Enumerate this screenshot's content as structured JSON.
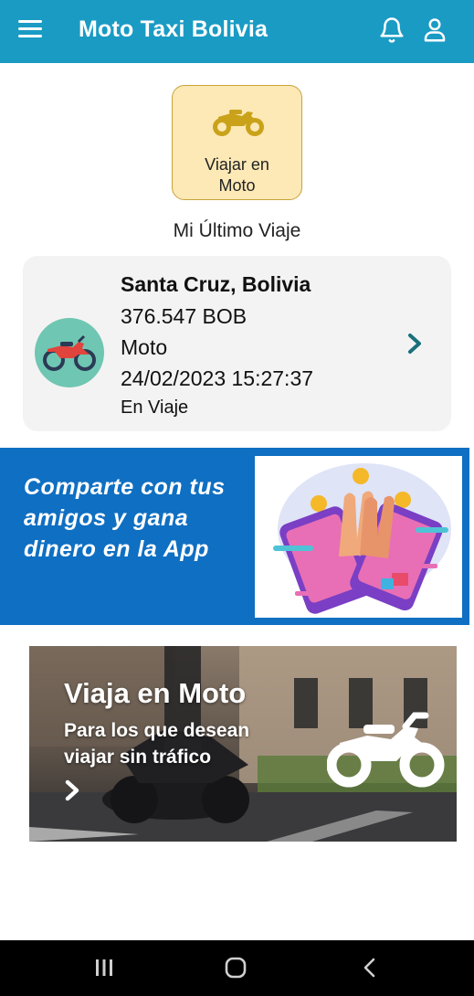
{
  "app": {
    "title": "Moto Taxi Bolivia"
  },
  "icons": {
    "menu": "hamburger-menu-icon",
    "notifications": "bell-icon",
    "profile": "user-icon"
  },
  "ride_option": {
    "label": "Viajar en Moto",
    "icon": "motorcycle-icon"
  },
  "last_trip": {
    "section_title": "Mi Último Viaje",
    "city": "Santa Cruz, Bolivia",
    "price": "376.547 BOB",
    "vehicle": "Moto",
    "datetime": "24/02/2023 15:27:37",
    "status": "En Viaje"
  },
  "promo": {
    "text": "Comparte con tus amigos y gana dinero en la App"
  },
  "banner": {
    "title": "Viaja en Moto",
    "subtitle": "Para los que desean viajar sin tráfico"
  },
  "colors": {
    "primary": "#1a9bc4",
    "promo_bg": "#0f6fc2",
    "ride_btn_bg": "#fde9b6",
    "moto_icon": "#c9a21a",
    "avatar_bg": "#6fc6b2",
    "chevron": "#1a6f7a"
  }
}
